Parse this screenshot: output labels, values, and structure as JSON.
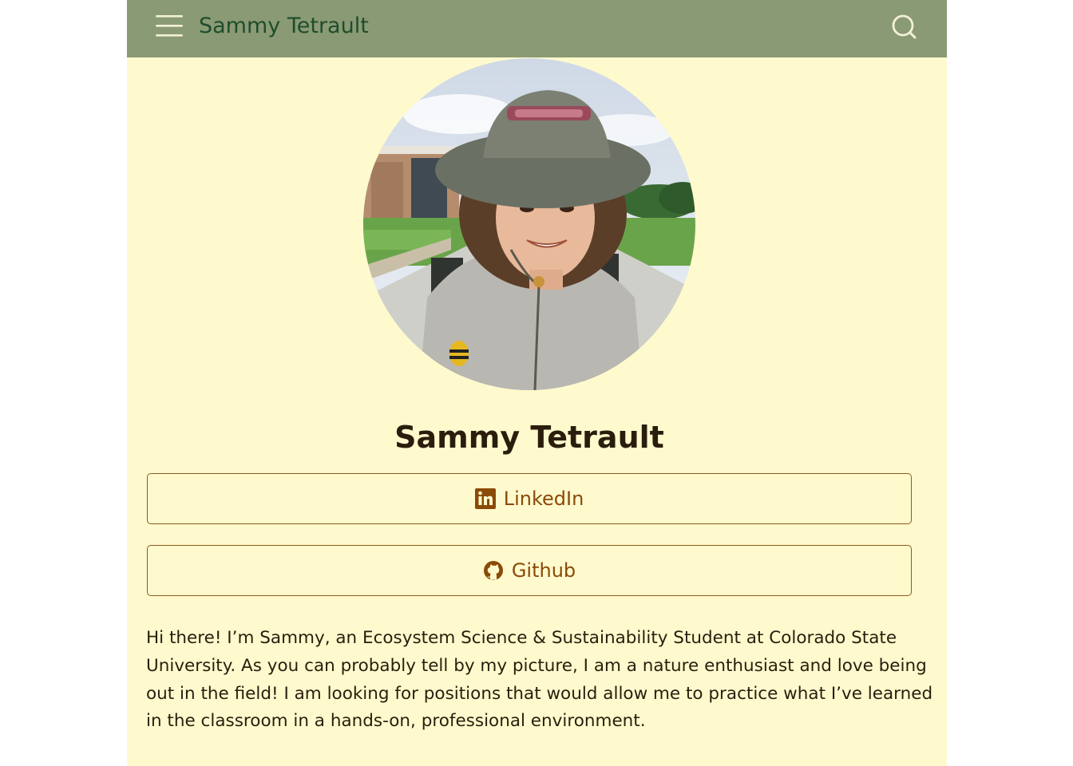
{
  "navbar": {
    "brand": "Sammy Tetrault",
    "menu_icon": "hamburger-menu-icon",
    "search_icon": "search-icon",
    "background": "#8a9a74"
  },
  "profile": {
    "photo": "profile photo of a person wearing a bucket hat outdoors",
    "name": "Sammy Tetrault"
  },
  "links": [
    {
      "label": "LinkedIn",
      "icon": "linkedin-icon"
    },
    {
      "label": "Github",
      "icon": "github-icon"
    }
  ],
  "bio": "Hi there! I’m Sammy, an Ecosystem Science & Sustainability Student at Colorado State University. As you can probably tell by my picture, I am a nature enthusiast and love being out in the field! I am looking for positions that would allow me to practice what I’ve learned in the classroom in a hands-on, professional environment.",
  "colors": {
    "page_background": "#fffacd",
    "accent": "#8b4a08",
    "text": "#2b1d0e",
    "brand_text": "#1f4d2c"
  }
}
